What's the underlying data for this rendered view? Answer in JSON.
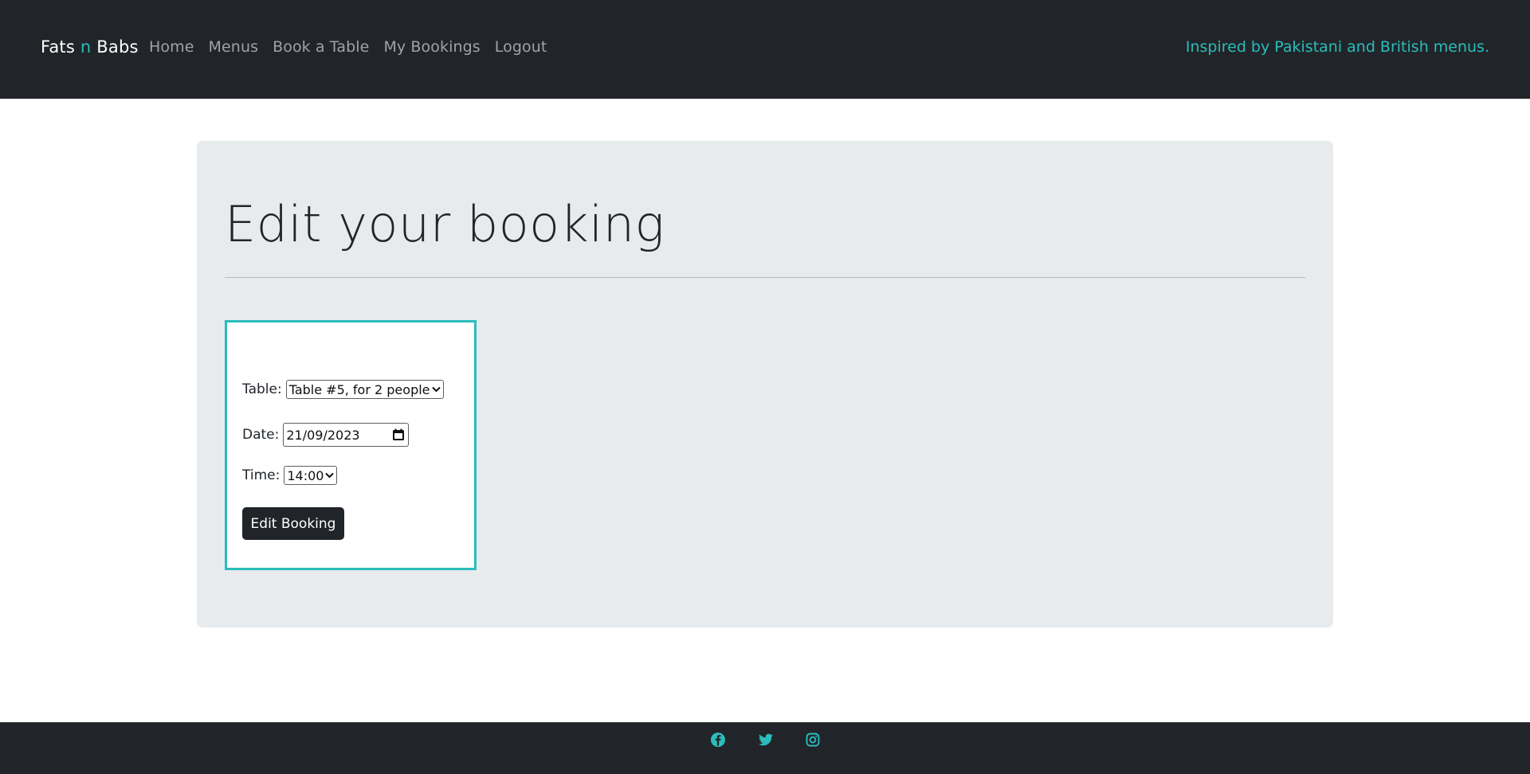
{
  "nav": {
    "brand_part1": "Fats ",
    "brand_accent": "n",
    "brand_part2": " Babs",
    "links": [
      "Home",
      "Menus",
      "Book a Table",
      "My Bookings",
      "Logout"
    ],
    "tagline": "Inspired by Pakistani and British menus."
  },
  "main": {
    "title": "Edit your booking",
    "form": {
      "table_label": "Table:",
      "table_value": "Table #5, for 2 people",
      "date_label": "Date:",
      "date_value": "21/09/2023",
      "time_label": "Time:",
      "time_value": "14:00",
      "submit_label": "Edit Booking"
    }
  },
  "footer": {
    "icons": [
      "facebook-icon",
      "twitter-icon",
      "instagram-icon"
    ]
  },
  "colors": {
    "accent": "#2bbcbc",
    "dark": "#212529",
    "panel": "#e7ebee"
  }
}
